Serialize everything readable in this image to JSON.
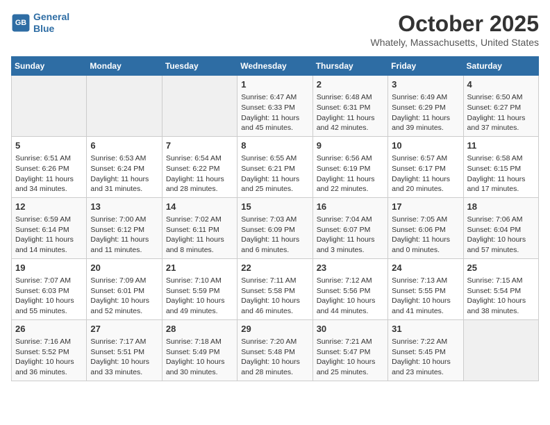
{
  "header": {
    "logo_line1": "General",
    "logo_line2": "Blue",
    "month": "October 2025",
    "location": "Whately, Massachusetts, United States"
  },
  "days_of_week": [
    "Sunday",
    "Monday",
    "Tuesday",
    "Wednesday",
    "Thursday",
    "Friday",
    "Saturday"
  ],
  "weeks": [
    [
      {
        "day": "",
        "info": ""
      },
      {
        "day": "",
        "info": ""
      },
      {
        "day": "",
        "info": ""
      },
      {
        "day": "1",
        "info": "Sunrise: 6:47 AM\nSunset: 6:33 PM\nDaylight: 11 hours and 45 minutes."
      },
      {
        "day": "2",
        "info": "Sunrise: 6:48 AM\nSunset: 6:31 PM\nDaylight: 11 hours and 42 minutes."
      },
      {
        "day": "3",
        "info": "Sunrise: 6:49 AM\nSunset: 6:29 PM\nDaylight: 11 hours and 39 minutes."
      },
      {
        "day": "4",
        "info": "Sunrise: 6:50 AM\nSunset: 6:27 PM\nDaylight: 11 hours and 37 minutes."
      }
    ],
    [
      {
        "day": "5",
        "info": "Sunrise: 6:51 AM\nSunset: 6:26 PM\nDaylight: 11 hours and 34 minutes."
      },
      {
        "day": "6",
        "info": "Sunrise: 6:53 AM\nSunset: 6:24 PM\nDaylight: 11 hours and 31 minutes."
      },
      {
        "day": "7",
        "info": "Sunrise: 6:54 AM\nSunset: 6:22 PM\nDaylight: 11 hours and 28 minutes."
      },
      {
        "day": "8",
        "info": "Sunrise: 6:55 AM\nSunset: 6:21 PM\nDaylight: 11 hours and 25 minutes."
      },
      {
        "day": "9",
        "info": "Sunrise: 6:56 AM\nSunset: 6:19 PM\nDaylight: 11 hours and 22 minutes."
      },
      {
        "day": "10",
        "info": "Sunrise: 6:57 AM\nSunset: 6:17 PM\nDaylight: 11 hours and 20 minutes."
      },
      {
        "day": "11",
        "info": "Sunrise: 6:58 AM\nSunset: 6:15 PM\nDaylight: 11 hours and 17 minutes."
      }
    ],
    [
      {
        "day": "12",
        "info": "Sunrise: 6:59 AM\nSunset: 6:14 PM\nDaylight: 11 hours and 14 minutes."
      },
      {
        "day": "13",
        "info": "Sunrise: 7:00 AM\nSunset: 6:12 PM\nDaylight: 11 hours and 11 minutes."
      },
      {
        "day": "14",
        "info": "Sunrise: 7:02 AM\nSunset: 6:11 PM\nDaylight: 11 hours and 8 minutes."
      },
      {
        "day": "15",
        "info": "Sunrise: 7:03 AM\nSunset: 6:09 PM\nDaylight: 11 hours and 6 minutes."
      },
      {
        "day": "16",
        "info": "Sunrise: 7:04 AM\nSunset: 6:07 PM\nDaylight: 11 hours and 3 minutes."
      },
      {
        "day": "17",
        "info": "Sunrise: 7:05 AM\nSunset: 6:06 PM\nDaylight: 11 hours and 0 minutes."
      },
      {
        "day": "18",
        "info": "Sunrise: 7:06 AM\nSunset: 6:04 PM\nDaylight: 10 hours and 57 minutes."
      }
    ],
    [
      {
        "day": "19",
        "info": "Sunrise: 7:07 AM\nSunset: 6:03 PM\nDaylight: 10 hours and 55 minutes."
      },
      {
        "day": "20",
        "info": "Sunrise: 7:09 AM\nSunset: 6:01 PM\nDaylight: 10 hours and 52 minutes."
      },
      {
        "day": "21",
        "info": "Sunrise: 7:10 AM\nSunset: 5:59 PM\nDaylight: 10 hours and 49 minutes."
      },
      {
        "day": "22",
        "info": "Sunrise: 7:11 AM\nSunset: 5:58 PM\nDaylight: 10 hours and 46 minutes."
      },
      {
        "day": "23",
        "info": "Sunrise: 7:12 AM\nSunset: 5:56 PM\nDaylight: 10 hours and 44 minutes."
      },
      {
        "day": "24",
        "info": "Sunrise: 7:13 AM\nSunset: 5:55 PM\nDaylight: 10 hours and 41 minutes."
      },
      {
        "day": "25",
        "info": "Sunrise: 7:15 AM\nSunset: 5:54 PM\nDaylight: 10 hours and 38 minutes."
      }
    ],
    [
      {
        "day": "26",
        "info": "Sunrise: 7:16 AM\nSunset: 5:52 PM\nDaylight: 10 hours and 36 minutes."
      },
      {
        "day": "27",
        "info": "Sunrise: 7:17 AM\nSunset: 5:51 PM\nDaylight: 10 hours and 33 minutes."
      },
      {
        "day": "28",
        "info": "Sunrise: 7:18 AM\nSunset: 5:49 PM\nDaylight: 10 hours and 30 minutes."
      },
      {
        "day": "29",
        "info": "Sunrise: 7:20 AM\nSunset: 5:48 PM\nDaylight: 10 hours and 28 minutes."
      },
      {
        "day": "30",
        "info": "Sunrise: 7:21 AM\nSunset: 5:47 PM\nDaylight: 10 hours and 25 minutes."
      },
      {
        "day": "31",
        "info": "Sunrise: 7:22 AM\nSunset: 5:45 PM\nDaylight: 10 hours and 23 minutes."
      },
      {
        "day": "",
        "info": ""
      }
    ]
  ]
}
